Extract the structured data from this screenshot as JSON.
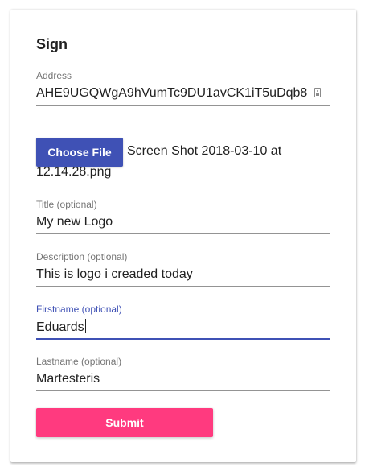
{
  "form": {
    "title": "Sign",
    "address": {
      "label": "Address",
      "value": "AHE9UGQWgA9hVumTc9DU1avCK1iT5uDqb8"
    },
    "file": {
      "button_label": "Choose File",
      "file_name_line1": "Screen Shot 2018-03-10 at",
      "file_name_line2": "12.14.28.png"
    },
    "title_field": {
      "label": "Title (optional)",
      "value": "My new Logo"
    },
    "description_field": {
      "label": "Description (optional)",
      "value": "This is logo i creaded today"
    },
    "firstname_field": {
      "label": "Firstname (optional)",
      "value": "Eduards"
    },
    "lastname_field": {
      "label": "Lastname (optional)",
      "value": "Martesteris"
    },
    "submit_label": "Submit"
  },
  "colors": {
    "primary": "#3f51b5",
    "accent": "#ff3a7f"
  },
  "icons": {
    "address_icon": "contact-card-icon"
  }
}
